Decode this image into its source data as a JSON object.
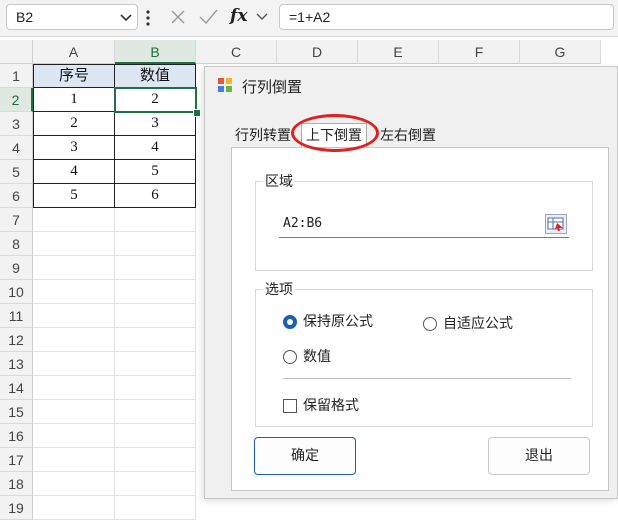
{
  "formula_bar": {
    "name_box": "B2",
    "formula": "=1+A2",
    "fx_label": "fx"
  },
  "sheet": {
    "columns": [
      "A",
      "B",
      "C",
      "D",
      "E",
      "F",
      "G"
    ],
    "selected_column": "B",
    "rows": [
      "1",
      "2",
      "3",
      "4",
      "5",
      "6",
      "7",
      "8",
      "9",
      "10",
      "11",
      "12",
      "13",
      "14",
      "15",
      "16",
      "17",
      "18",
      "19"
    ],
    "selected_row": "2",
    "headers": [
      "序号",
      "数值"
    ],
    "data": [
      [
        "1",
        "2"
      ],
      [
        "2",
        "3"
      ],
      [
        "3",
        "4"
      ],
      [
        "4",
        "5"
      ],
      [
        "5",
        "6"
      ]
    ],
    "colors": {
      "selection": "#1e7145",
      "header_fill": "#dde6f3"
    }
  },
  "dialog": {
    "title": "行列倒置",
    "tabs": [
      {
        "label": "行列转置",
        "active": false
      },
      {
        "label": "上下倒置",
        "active": true
      },
      {
        "label": "左右倒置",
        "active": false
      }
    ],
    "range_group": {
      "label": "区域",
      "value": "A2:B6",
      "picker_icon": "range-picker-icon"
    },
    "options_group": {
      "label": "选项",
      "radios": [
        {
          "label": "保持原公式",
          "checked": true
        },
        {
          "label": "自适应公式",
          "checked": false
        },
        {
          "label": "数值",
          "checked": false
        }
      ],
      "checkbox": {
        "label": "保留格式",
        "checked": false
      }
    },
    "ok_label": "确定",
    "exit_label": "退出",
    "accent": "#1a5fb4",
    "annotation_color": "#e0201c"
  }
}
